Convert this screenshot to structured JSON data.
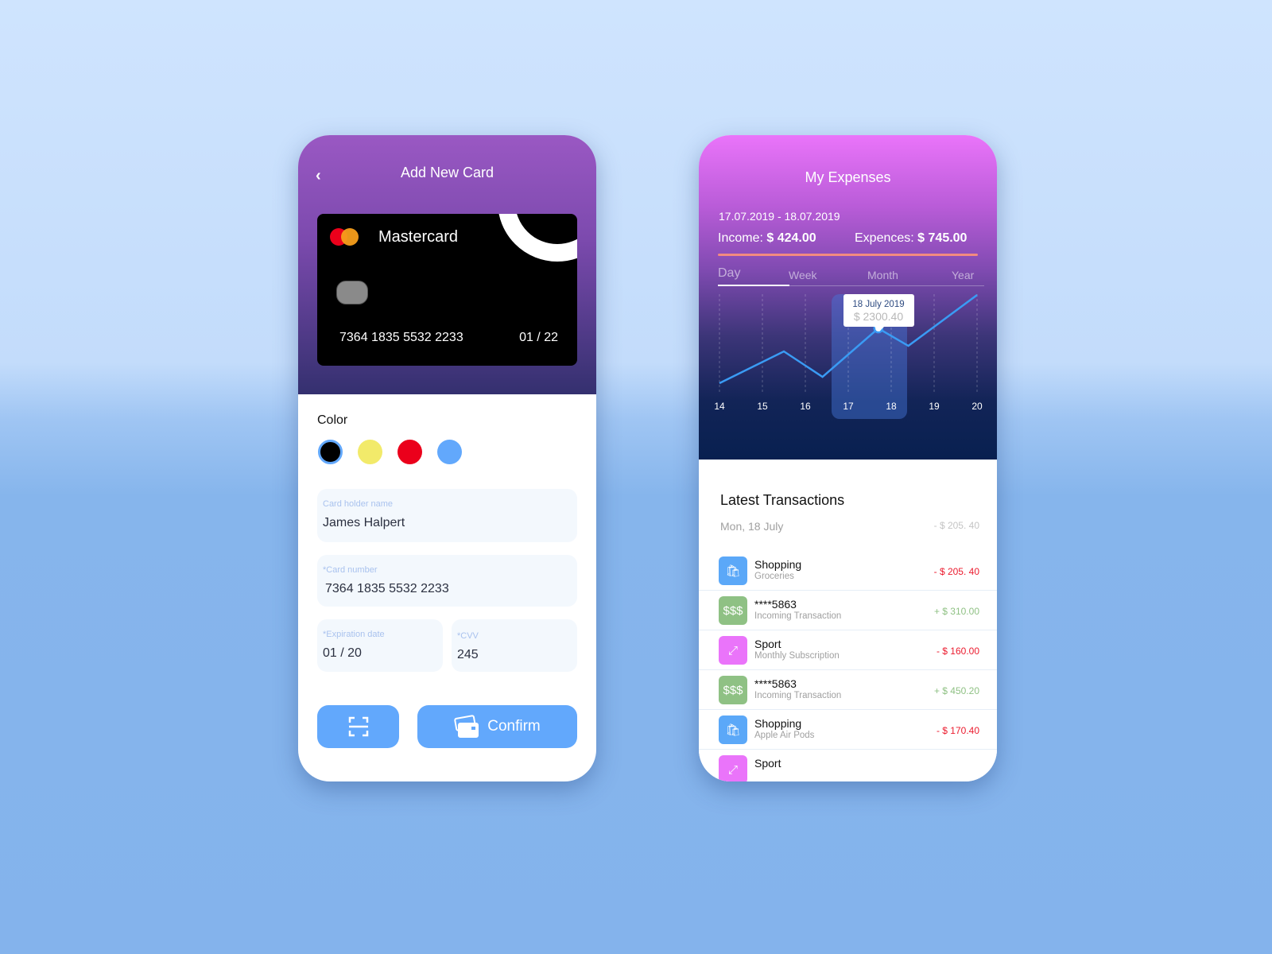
{
  "add_card": {
    "title": "Add New Card",
    "card": {
      "brand": "Mastercard",
      "number": "7364 1835 5532 2233",
      "expiry": "01 / 22"
    },
    "color_label": "Color",
    "colors": [
      "#000000",
      "#f2ea6a",
      "#eb001b",
      "#62a8fc"
    ],
    "selected_color": "#000000",
    "fields": {
      "holder_label": "Card holder name",
      "holder_value": "James Halpert",
      "number_label": "*Card number",
      "number_value": "7364 1835 5532 2233",
      "exp_label": "*Expiration date",
      "exp_value": "01 / 20",
      "cvv_label": "*CVV",
      "cvv_value": "245"
    },
    "confirm_label": "Confirm"
  },
  "expenses": {
    "title": "My Expenses",
    "date_range": "17.07.2019 - 18.07.2019",
    "income_label": "Income:",
    "income_value": "$ 424.00",
    "expenses_label": "Expences:",
    "expenses_value": "$ 745.00",
    "tabs": [
      "Day",
      "Week",
      "Month",
      "Year"
    ],
    "active_tab": "Day",
    "tooltip": {
      "date": "18 July 2019",
      "value": "$ 2300.40"
    }
  },
  "chart_data": {
    "type": "line",
    "x_ticks": [
      "14",
      "15",
      "16",
      "17",
      "18",
      "19",
      "20"
    ],
    "x": [
      14,
      15.5,
      16.4,
      17.7,
      18.4,
      20
    ],
    "y": [
      476,
      1534,
      687,
      2300.4,
      1719,
      3411
    ],
    "highlight_x": 17.7,
    "grid": "vertical dashed",
    "line_color": "#3a9bf4"
  },
  "transactions": {
    "title": "Latest Transactions",
    "day": "Mon, 18 July",
    "day_total": "- $ 205. 40",
    "items": [
      {
        "title": "Shopping",
        "sub": "Groceries",
        "amount": "- $ 205. 40",
        "type": "shopping"
      },
      {
        "title": "****5863",
        "sub": "Incoming Transaction",
        "amount": "+ $ 310.00",
        "type": "income"
      },
      {
        "title": "Sport",
        "sub": "Monthly Subscription",
        "amount": "- $ 160.00",
        "type": "sport"
      },
      {
        "title": "****5863",
        "sub": "Incoming Transaction",
        "amount": "+ $ 450.20",
        "type": "income"
      },
      {
        "title": "Shopping",
        "sub": "Apple Air Pods",
        "amount": "- $ 170.40",
        "type": "shopping"
      },
      {
        "title": "Sport",
        "sub": "",
        "amount": "",
        "type": "sport"
      }
    ]
  }
}
